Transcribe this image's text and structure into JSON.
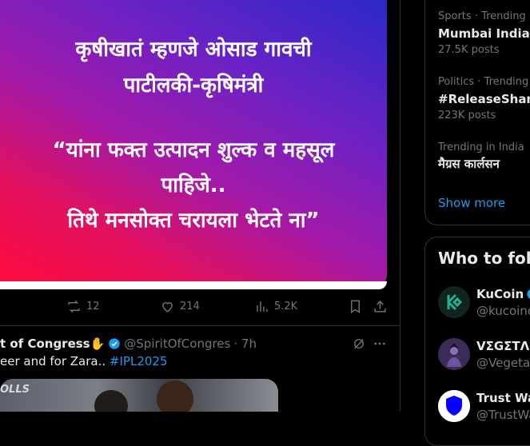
{
  "post": {
    "image_lines": [
      "कृषीखातं म्हणजे ओसाड गावची",
      "पाटीलकी-कृषिमंत्री",
      "“यांना फक्त उत्पादन शुल्क व महसूल",
      "पाहिजे..",
      "तिथे मनसोक्त चरायला भेटते ना”"
    ],
    "retweets": "12",
    "likes": "214",
    "views": "5.2K"
  },
  "next_tweet": {
    "name": "t of Congress✋",
    "handle": "@SpiritOfCongres",
    "time": "· 7h",
    "text": "eer and for Zara..",
    "hashtag": "#IPL2025",
    "media_label": "OLLS"
  },
  "trends": [
    {
      "meta": "Sports · Trending",
      "title": "Mumbai Indians",
      "count": "27.5K posts"
    },
    {
      "meta": "Politics · Trending",
      "title": "#ReleaseSharm",
      "count": "223K posts"
    },
    {
      "meta": "Trending in India",
      "title": "मैग्रस कार्लसन",
      "count": ""
    }
  ],
  "show_more": "Show more",
  "who_to_follow": {
    "title": "Who to follo",
    "accounts": [
      {
        "name": "KuCoin",
        "handle": "@kucoincom"
      },
      {
        "name": "VΣGΣTΛ",
        "handle": "@VegetaC"
      },
      {
        "name": "Trust Wal",
        "handle": "@TrustWal"
      }
    ]
  },
  "colors": {
    "accent": "#1d9bf0",
    "muted": "#71767b",
    "kucoin": "#23af91"
  }
}
